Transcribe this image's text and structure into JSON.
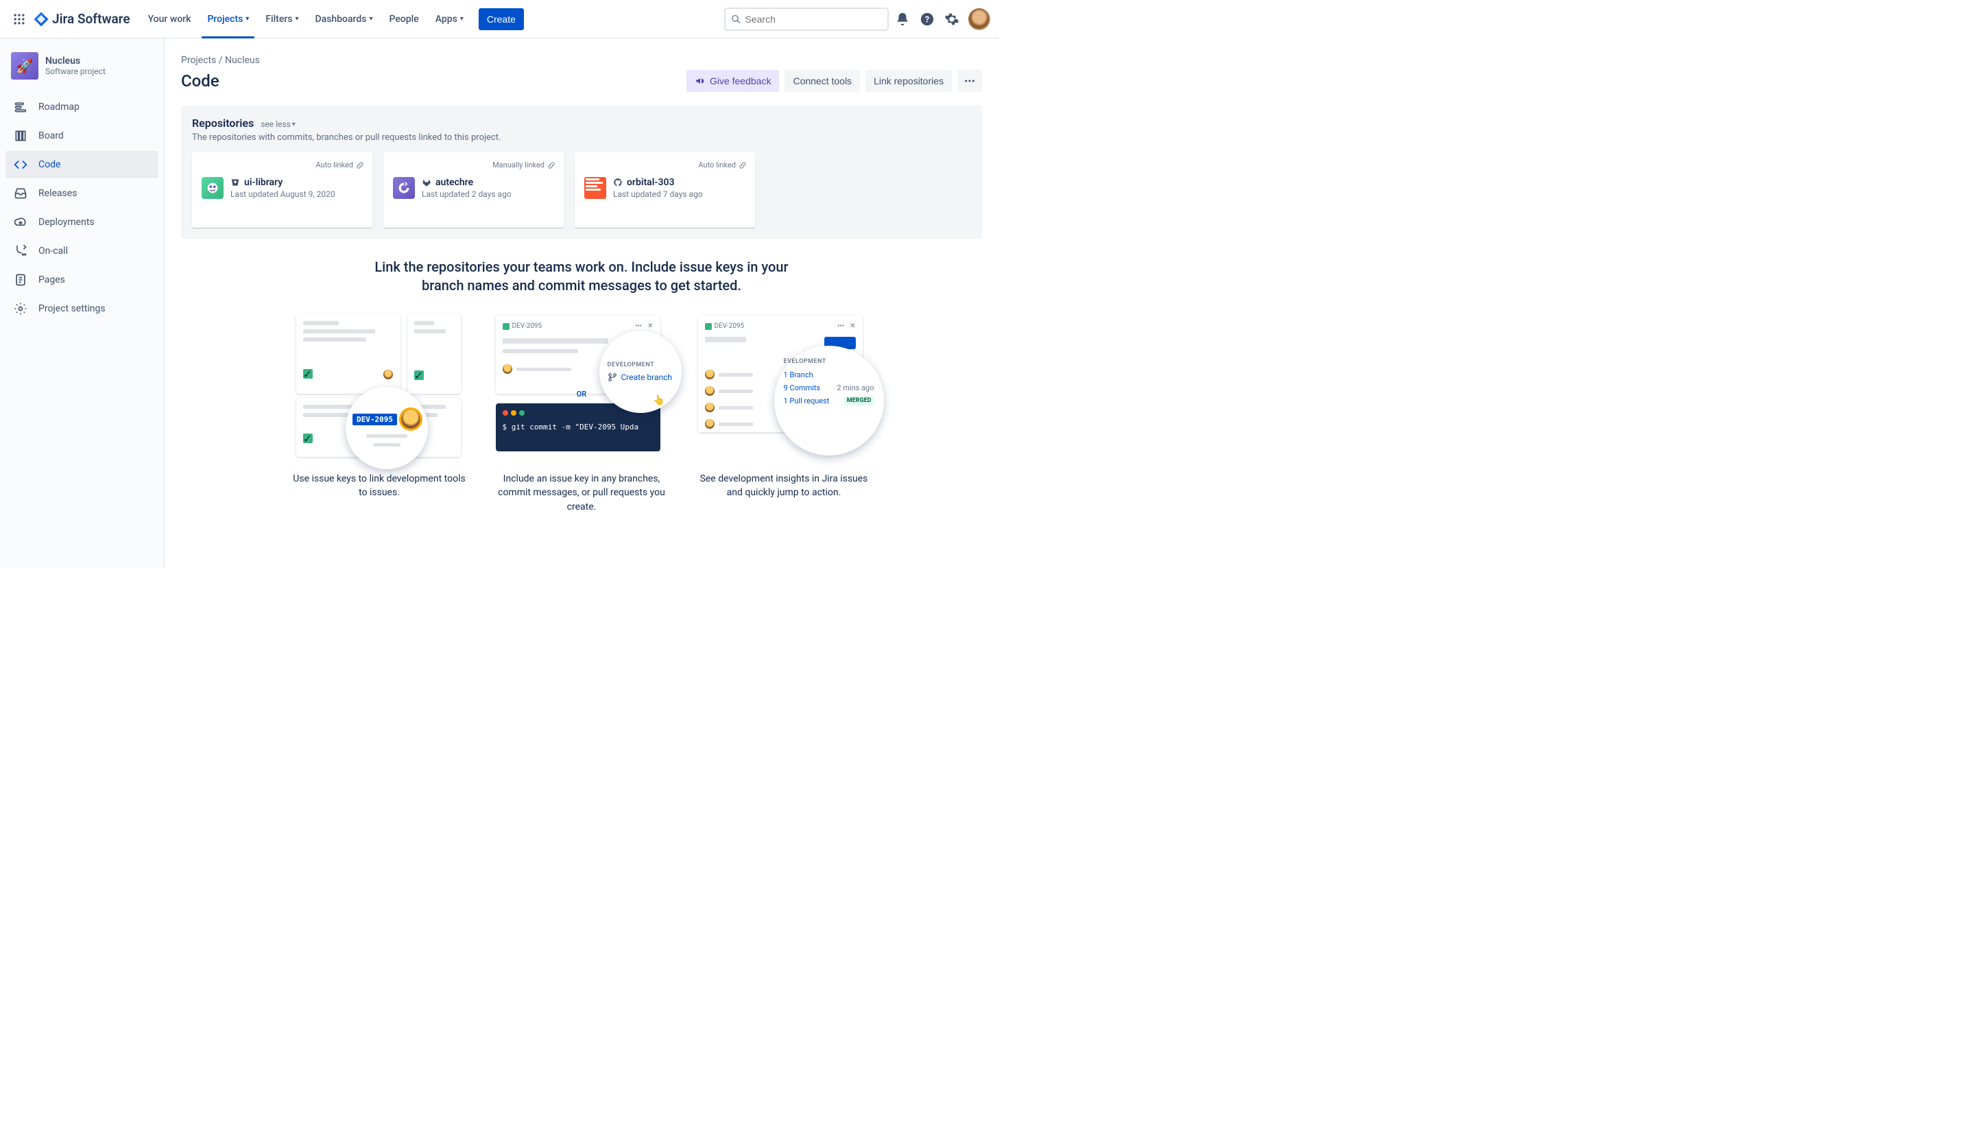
{
  "topnav": {
    "logo_text": "Jira Software",
    "items": [
      "Your work",
      "Projects",
      "Filters",
      "Dashboards",
      "People",
      "Apps"
    ],
    "active_index": 1,
    "dropdown_indices": [
      1,
      2,
      3,
      5
    ],
    "create_label": "Create",
    "search_placeholder": "Search"
  },
  "sidebar": {
    "project_name": "Nucleus",
    "project_type": "Software project",
    "items": [
      "Roadmap",
      "Board",
      "Code",
      "Releases",
      "Deployments",
      "On-call",
      "Pages",
      "Project settings"
    ],
    "active_index": 2
  },
  "breadcrumb": "Projects / Nucleus",
  "page_title": "Code",
  "actions": {
    "feedback": "Give feedback",
    "connect": "Connect tools",
    "link_repos": "Link repositories"
  },
  "repo_panel": {
    "title": "Repositories",
    "toggle": "see less",
    "desc": "The repositories with commits, branches or pull requests linked to this project.",
    "link_types": [
      "Auto linked",
      "Manually linked",
      "Auto linked"
    ],
    "repos": [
      {
        "name": "ui-library",
        "updated": "Last updated August 9, 2020",
        "provider": "bitbucket"
      },
      {
        "name": "autechre",
        "updated": "Last updated 2 days ago",
        "provider": "gitlab"
      },
      {
        "name": "orbital-303",
        "updated": "Last updated 7 days ago",
        "provider": "github"
      }
    ]
  },
  "hero_text": "Link the repositories your teams work on. Include issue keys in your branch names and commit messages to get started.",
  "hero": {
    "c1": {
      "caption": "Use issue keys to link development tools to issues.",
      "key": "DEV-2095"
    },
    "c2": {
      "caption": "Include an issue key in any branches, commit messages, or pull requests you create.",
      "key": "DEV-2095",
      "or": "OR",
      "dev_label": "DEVELOPMENT",
      "create_branch": "Create branch",
      "terminal": "$ git commit -m \"DEV-2095 Upda"
    },
    "c3": {
      "caption": "See development insights in Jira issues and quickly jump to action.",
      "key": "DEV-2095",
      "dev_label": "EVELOPMENT",
      "branch": "1 Branch",
      "commits": "9 Commits",
      "pr": "1 Pull request",
      "time": "2 mins ago",
      "merged": "MERGED"
    }
  }
}
